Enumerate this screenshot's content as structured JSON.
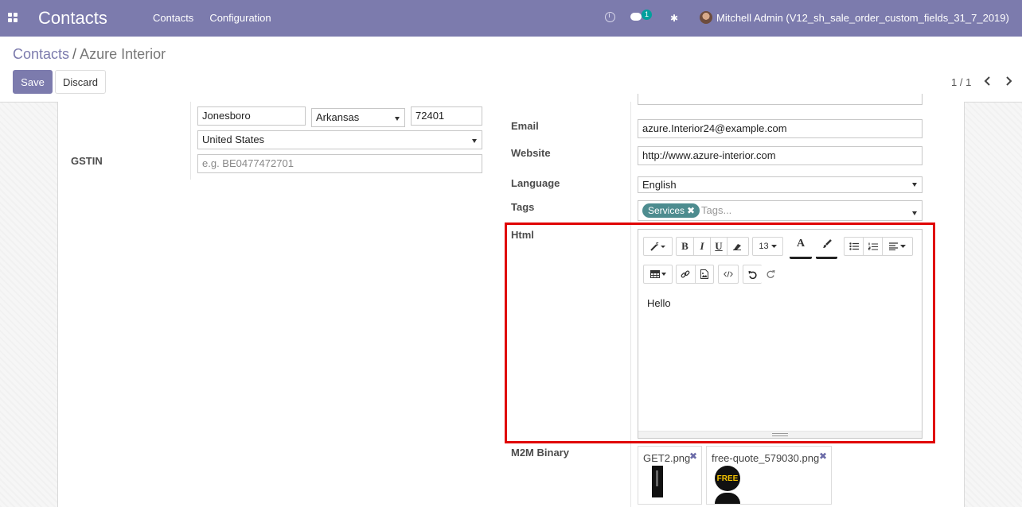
{
  "app": {
    "title": "Contacts"
  },
  "nav": {
    "items": [
      "Contacts",
      "Configuration"
    ],
    "chat_count": "1",
    "user": "Mitchell Admin (V12_sh_sale_order_custom_fields_31_7_2019)"
  },
  "breadcrumb": {
    "parent": "Contacts",
    "separator": "/",
    "current": "Azure Interior"
  },
  "buttons": {
    "save": "Save",
    "discard": "Discard"
  },
  "pager": {
    "value": "1 / 1"
  },
  "address": {
    "city": "Jonesboro",
    "state": "Arkansas",
    "zip": "72401",
    "country": "United States"
  },
  "gstin": {
    "label": "GSTIN",
    "placeholder": "e.g. BE0477472701"
  },
  "fields": {
    "email_label": "Email",
    "email": "azure.Interior24@example.com",
    "website_label": "Website",
    "website": "http://www.azure-interior.com",
    "language_label": "Language",
    "language": "English",
    "tags_label": "Tags",
    "tag": "Services",
    "tags_placeholder": "Tags...",
    "html_label": "Html",
    "html_content": "Hello",
    "m2m_label": "M2M Binary"
  },
  "editor": {
    "font_size": "13"
  },
  "attachments": [
    {
      "name": "GET2.png"
    },
    {
      "name": "free-quote_579030.png"
    }
  ],
  "attachment_image_text": {
    "free": "FREE"
  }
}
